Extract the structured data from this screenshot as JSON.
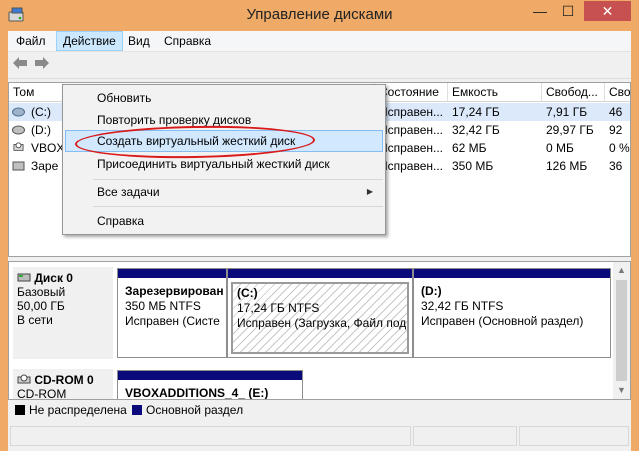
{
  "window": {
    "title": "Управление дисками",
    "minimize_glyph": "—",
    "maximize_glyph": "☐",
    "close_glyph": "✕"
  },
  "menu": {
    "items": [
      "Файл",
      "Действие",
      "Вид",
      "Справка"
    ]
  },
  "toolbar": {
    "back_icon": "arrow-left-icon",
    "forward_icon": "arrow-right-icon"
  },
  "volume_table": {
    "columns": [
      "Том",
      "Состояние",
      "Емкость",
      "Свобод...",
      "Сво"
    ],
    "rows": [
      {
        "name": "(C:)",
        "state": "Исправен...",
        "capacity": "17,24 ГБ",
        "free": "7,91 ГБ",
        "pct": "46"
      },
      {
        "name": "(D:)",
        "state": "Исправен...",
        "capacity": "32,42 ГБ",
        "free": "29,97 ГБ",
        "pct": "92"
      },
      {
        "name": "VBOX",
        "state": "Исправен...",
        "capacity": "62 МБ",
        "free": "0 МБ",
        "pct": "0 %"
      },
      {
        "name": "Заре",
        "state": "Исправен...",
        "capacity": "350 МБ",
        "free": "126 МБ",
        "pct": "36"
      }
    ]
  },
  "action_menu": {
    "items": [
      "Обновить",
      "Повторить проверку дисков",
      "Создать виртуальный жесткий диск",
      "Присоединить виртуальный жесткий диск",
      "Все задачи",
      "Справка"
    ],
    "submenu_arrow": "▶"
  },
  "disks": [
    {
      "name": "Диск 0",
      "type": "Базовый",
      "size": "50,00 ГБ",
      "status": "В сети",
      "partitions": [
        {
          "name": "Зарезервирован",
          "size": "350 МБ NTFS",
          "status": "Исправен (Систе"
        },
        {
          "name": "(C:)",
          "size": "17,24 ГБ NTFS",
          "status": "Исправен (Загрузка, Файл подк"
        },
        {
          "name": "(D:)",
          "size": "32,42 ГБ NTFS",
          "status": "Исправен (Основной раздел)"
        }
      ]
    },
    {
      "name": "CD-ROM 0",
      "type": "CD-ROM",
      "partitions": [
        {
          "name": "VBOXADDITIONS_4_ (E:)"
        }
      ]
    }
  ],
  "legend": {
    "items": [
      {
        "label": "Не распределена",
        "color": "#000000"
      },
      {
        "label": "Основной раздел",
        "color": "#0a0a7a"
      }
    ]
  },
  "colors": {
    "window_frame": "#eeaa66",
    "highlight": "#d1e8ff",
    "annotation": "#d91a1a",
    "partition_bar": "#0a0a7a"
  }
}
